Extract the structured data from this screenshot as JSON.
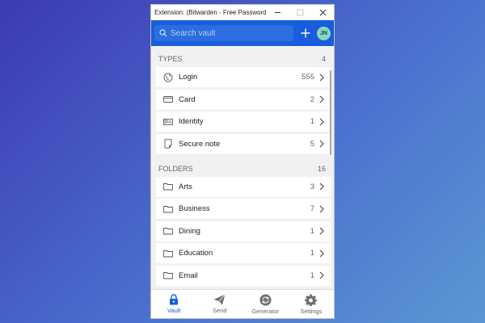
{
  "window": {
    "title": "Extension: (Bitwarden - Free Password..."
  },
  "header": {
    "search_placeholder": "Search vault",
    "avatar_initials": "JN"
  },
  "types": {
    "heading": "TYPES",
    "count": "4",
    "items": [
      {
        "label": "Login",
        "count": "555",
        "icon": "globe-icon"
      },
      {
        "label": "Card",
        "count": "2",
        "icon": "credit-card-icon"
      },
      {
        "label": "Identity",
        "count": "1",
        "icon": "id-card-icon"
      },
      {
        "label": "Secure note",
        "count": "5",
        "icon": "note-icon"
      }
    ]
  },
  "folders": {
    "heading": "FOLDERS",
    "count": "16",
    "items": [
      {
        "label": "Arts",
        "count": "3",
        "icon": "folder-icon"
      },
      {
        "label": "Business",
        "count": "7",
        "icon": "folder-icon"
      },
      {
        "label": "Dining",
        "count": "1",
        "icon": "folder-icon"
      },
      {
        "label": "Education",
        "count": "1",
        "icon": "folder-icon"
      },
      {
        "label": "Email",
        "count": "1",
        "icon": "folder-icon"
      }
    ]
  },
  "tabs": [
    {
      "label": "Vault",
      "icon": "lock-icon",
      "active": true
    },
    {
      "label": "Send",
      "icon": "paper-plane-icon",
      "active": false
    },
    {
      "label": "Generator",
      "icon": "generator-icon",
      "active": false
    },
    {
      "label": "Settings",
      "icon": "gear-icon",
      "active": false
    }
  ],
  "colors": {
    "brand": "#175ddc",
    "avatar": "#88d7c4"
  }
}
